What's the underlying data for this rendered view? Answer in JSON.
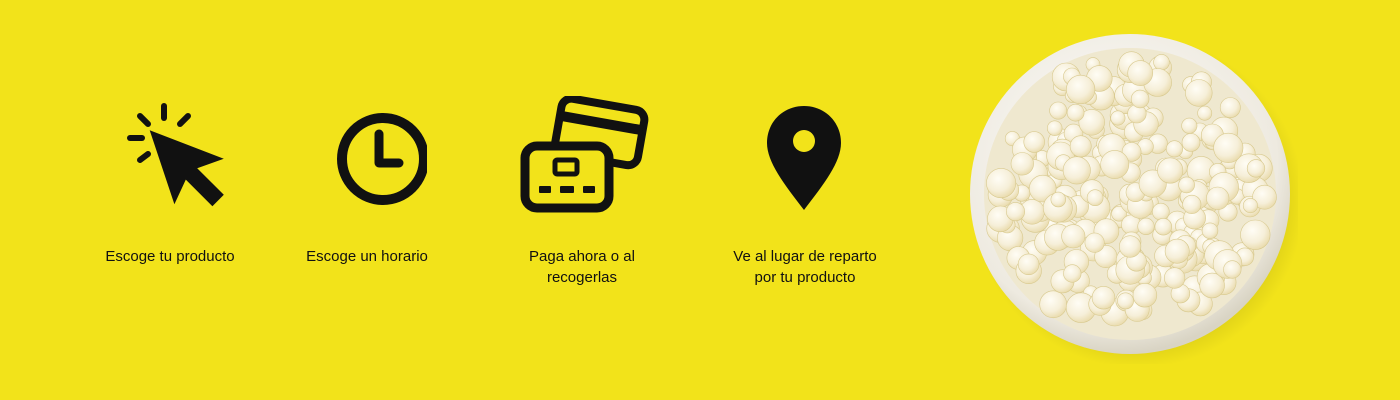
{
  "colors": {
    "background": "#f2e31a",
    "icon": "#111111",
    "text": "#111111"
  },
  "steps": [
    {
      "icon": "cursor-click-icon",
      "label": "Escoge tu producto"
    },
    {
      "icon": "clock-icon",
      "label": "Escoge un horario"
    },
    {
      "icon": "credit-cards-icon",
      "label": "Paga ahora o al recogerlas"
    },
    {
      "icon": "location-pin-icon",
      "label": "Ve al lugar de reparto por tu producto"
    }
  ]
}
